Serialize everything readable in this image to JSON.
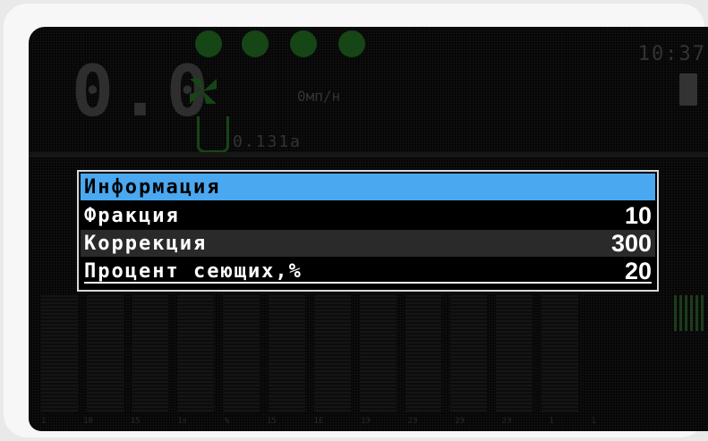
{
  "background": {
    "speed_value": "0.0",
    "clock": "10:37",
    "rate_unit": "0мп/н",
    "hopper_value": "0.131а",
    "axis_labels": [
      "1",
      "10",
      "15",
      "1s",
      "%",
      "15",
      "1E",
      "1Э",
      "2Э",
      "2Э",
      "2Э",
      "1",
      "1"
    ]
  },
  "popup": {
    "title": "Информация",
    "rows": [
      {
        "label": "Фракция",
        "value": "10"
      },
      {
        "label": "Коррекция",
        "value": "300"
      },
      {
        "label": "Процент сеющих,%",
        "value": "20"
      }
    ]
  },
  "colors": {
    "header_bg": "#4aa8f0",
    "selected_row_bg": "#2a2a2a",
    "dim_green": "#164516"
  },
  "icons": [
    "seed-icon",
    "fan-icon",
    "hopper-icon",
    "battery-icon"
  ]
}
